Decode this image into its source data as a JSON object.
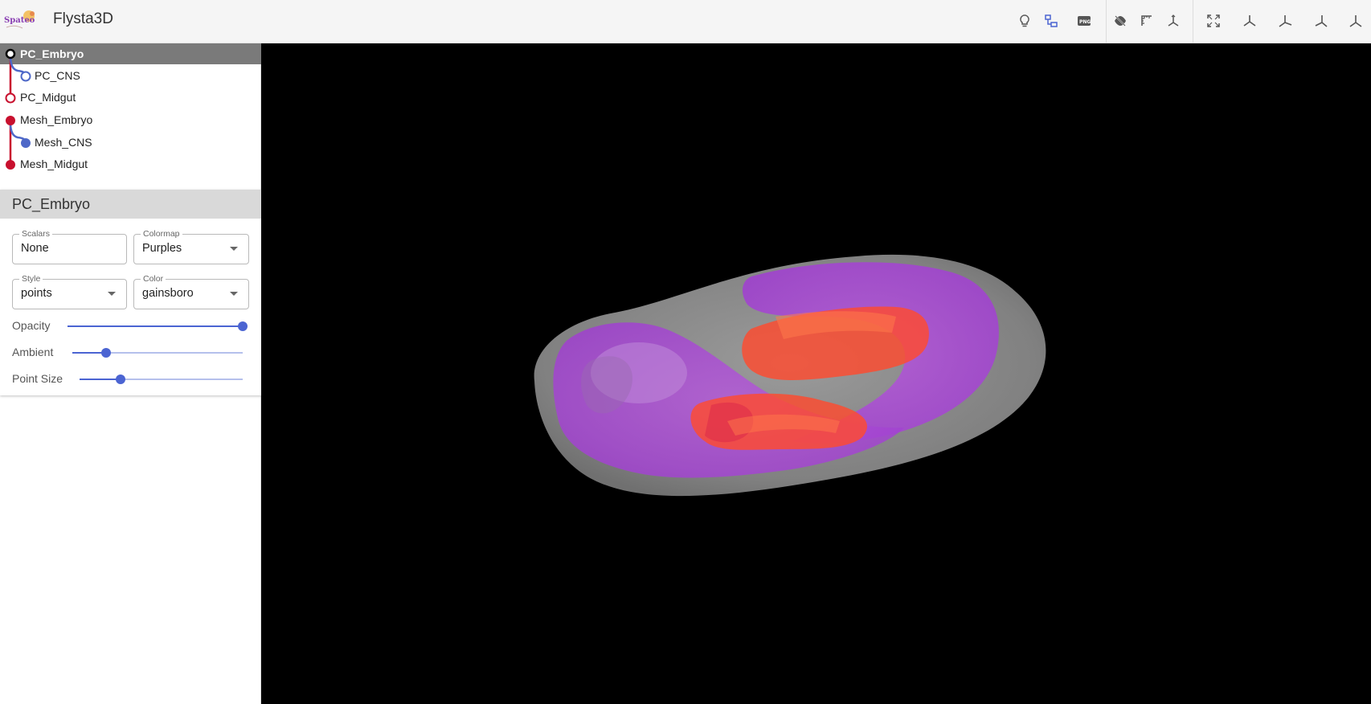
{
  "app": {
    "logo_text": "Spateo",
    "title": "Flysta3D"
  },
  "toolbar": {
    "icons": [
      "lightbulb-icon",
      "view-layout-icon",
      "png-export-icon",
      "hide-icon",
      "ruler-icon",
      "axes-grid-icon",
      "fullscreen-icon",
      "view-axis-x-icon",
      "view-axis-y-icon",
      "view-axis-z-icon",
      "view-axis-isometric-icon"
    ],
    "png_text": "PNG"
  },
  "tree": {
    "items": [
      {
        "label": "PC_Embryo",
        "indent": 0,
        "marker": "hollow",
        "color": "#000000"
      },
      {
        "label": "PC_CNS",
        "indent": 1,
        "marker": "hollow",
        "color": "#4e68c8"
      },
      {
        "label": "PC_Midgut",
        "indent": 0,
        "marker": "hollow",
        "color": "#c8102e"
      },
      {
        "label": "Mesh_Embryo",
        "indent": 0,
        "marker": "filled",
        "color": "#c8102e"
      },
      {
        "label": "Mesh_CNS",
        "indent": 1,
        "marker": "filled",
        "color": "#4e68c8"
      },
      {
        "label": "Mesh_Midgut",
        "indent": 0,
        "marker": "filled",
        "color": "#c8102e"
      }
    ],
    "selected_index": 0
  },
  "panel": {
    "title": "PC_Embryo",
    "scalars": {
      "label": "Scalars",
      "value": "None"
    },
    "colormap": {
      "label": "Colormap",
      "value": "Purples"
    },
    "style": {
      "label": "Style",
      "value": "points"
    },
    "color": {
      "label": "Color",
      "value": "gainsboro"
    },
    "opacity": {
      "label": "Opacity",
      "value": 1.0
    },
    "ambient": {
      "label": "Ambient",
      "value": 0.2
    },
    "point_size": {
      "label": "Point Size",
      "value": 0.25
    }
  },
  "colors": {
    "accent": "#4b64d2",
    "tree_red": "#c8102e",
    "tree_blue": "#4e68c8",
    "mesh_gray": "#bdbdbd",
    "mesh_purple": "#b347e6",
    "mesh_red": "#ff3a2a"
  }
}
